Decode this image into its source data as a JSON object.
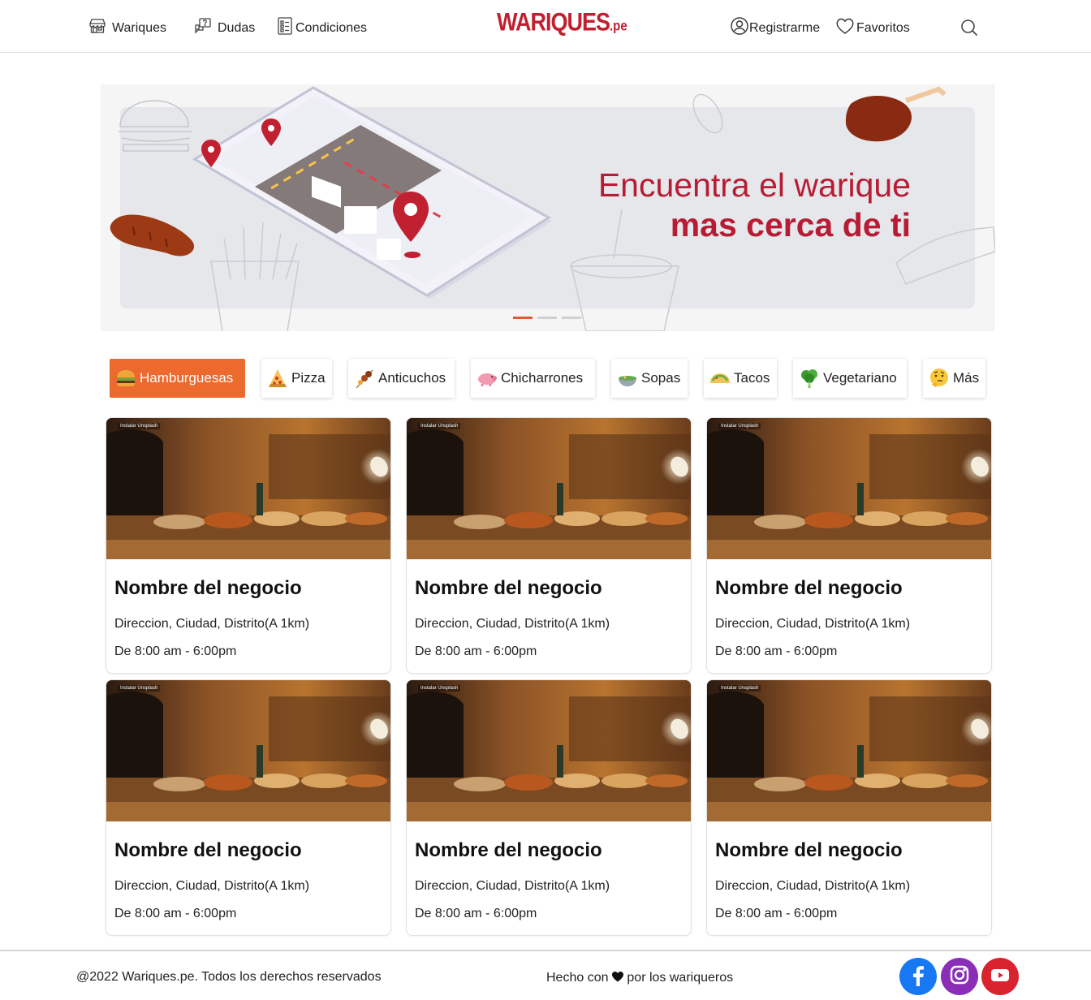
{
  "header": {
    "nav_left": [
      {
        "label": "Wariques",
        "icon": "store-icon"
      },
      {
        "label": "Dudas",
        "icon": "question-bubble-icon"
      },
      {
        "label": "Condiciones",
        "icon": "checklist-icon"
      }
    ],
    "logo": {
      "main": "WARIQUES",
      "suffix": ".pe"
    },
    "nav_right": [
      {
        "label": "Registrarme",
        "icon": "user-circle-icon"
      },
      {
        "label": "Favoritos",
        "icon": "heart-icon"
      }
    ],
    "search_icon": "search-icon"
  },
  "banner": {
    "line1": "Encuentra el warique",
    "line2": "mas cerca de ti",
    "slides": 3,
    "active_slide": 1
  },
  "categories": [
    {
      "label": "Hamburguesas",
      "icon": "burger-icon",
      "active": true
    },
    {
      "label": "Pizza",
      "icon": "pizza-icon",
      "active": false
    },
    {
      "label": "Anticuchos",
      "icon": "skewer-icon",
      "active": false
    },
    {
      "label": "Chicharrones",
      "icon": "pig-icon",
      "active": false
    },
    {
      "label": "Sopas",
      "icon": "soup-icon",
      "active": false
    },
    {
      "label": "Tacos",
      "icon": "taco-icon",
      "active": false
    },
    {
      "label": "Vegetariano",
      "icon": "broccoli-icon",
      "active": false
    },
    {
      "label": "Más",
      "icon": "thinking-face-icon",
      "active": false
    }
  ],
  "cards": [
    {
      "photo_tag": "Instalar Unsplash",
      "name": "Nombre del negocio",
      "address": "Direccion, Ciudad, Distrito(A 1km)",
      "hours": "De 8:00 am - 6:00pm"
    },
    {
      "photo_tag": "Instalar Unsplash",
      "name": "Nombre del negocio",
      "address": "Direccion, Ciudad, Distrito(A 1km)",
      "hours": "De 8:00 am - 6:00pm"
    },
    {
      "photo_tag": "Instalar Unsplash",
      "name": "Nombre del negocio",
      "address": "Direccion, Ciudad, Distrito(A 1km)",
      "hours": "De 8:00 am - 6:00pm"
    },
    {
      "photo_tag": "Instalar Unsplash",
      "name": "Nombre del negocio",
      "address": "Direccion, Ciudad, Distrito(A 1km)",
      "hours": "De 8:00 am - 6:00pm"
    },
    {
      "photo_tag": "Instalar Unsplash",
      "name": "Nombre del negocio",
      "address": "Direccion, Ciudad, Distrito(A 1km)",
      "hours": "De 8:00 am - 6:00pm"
    },
    {
      "photo_tag": "Instalar Unsplash",
      "name": "Nombre del negocio",
      "address": "Direccion, Ciudad, Distrito(A 1km)",
      "hours": "De 8:00 am - 6:00pm"
    }
  ],
  "footer": {
    "copyright": "@2022 Wariques.pe. Todos los derechos reservados",
    "made_prefix": "Hecho con",
    "made_suffix": "por los wariqueros",
    "social": [
      {
        "icon": "facebook-icon",
        "color": "#1877f2"
      },
      {
        "icon": "instagram-icon",
        "color": "#8a2eb8"
      },
      {
        "icon": "youtube-icon",
        "color": "#d9232e"
      }
    ]
  },
  "colors": {
    "brand_red": "#c0202f",
    "accent_orange": "#ec6a2e"
  }
}
